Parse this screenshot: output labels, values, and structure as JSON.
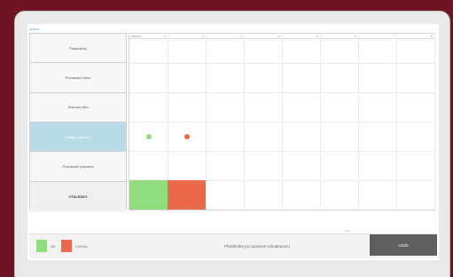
{
  "header": {
    "label": "Matice"
  },
  "rows": [
    {
      "label": "Poslouchej",
      "state": "normal"
    },
    {
      "label": "Poznávání filmu",
      "state": "normal"
    },
    {
      "label": "Dokonči větu",
      "state": "normal"
    },
    {
      "label": "Hledat odpověď",
      "state": "active"
    },
    {
      "label": "Poznávání písmene",
      "state": "normal"
    },
    {
      "label": "VÝSLEDKY",
      "state": "bold"
    }
  ],
  "grid": {
    "header_labels": [
      "Aktivita",
      "1",
      "2",
      "3",
      "4",
      "5",
      "6",
      "7",
      "8"
    ],
    "marks": [
      {
        "row": 3,
        "col": 0,
        "status": "ok"
      },
      {
        "row": 3,
        "col": 1,
        "status": "chyba"
      }
    ],
    "results": {
      "ok_cols": 1,
      "chyba_cols": 1
    }
  },
  "legend": [
    {
      "label": "OK",
      "color": "#8fdd7f"
    },
    {
      "label": "CHYBA",
      "color": "#ea6a4a"
    }
  ],
  "footer": {
    "meta": "0/1/1",
    "message": "Přetáhněte pro správné vyhodnocení",
    "submit_label": "Uložit"
  },
  "colors": {
    "ok": "#8fdd7f",
    "chyba": "#ea6a4a",
    "active_row": "#b9dbe8"
  }
}
